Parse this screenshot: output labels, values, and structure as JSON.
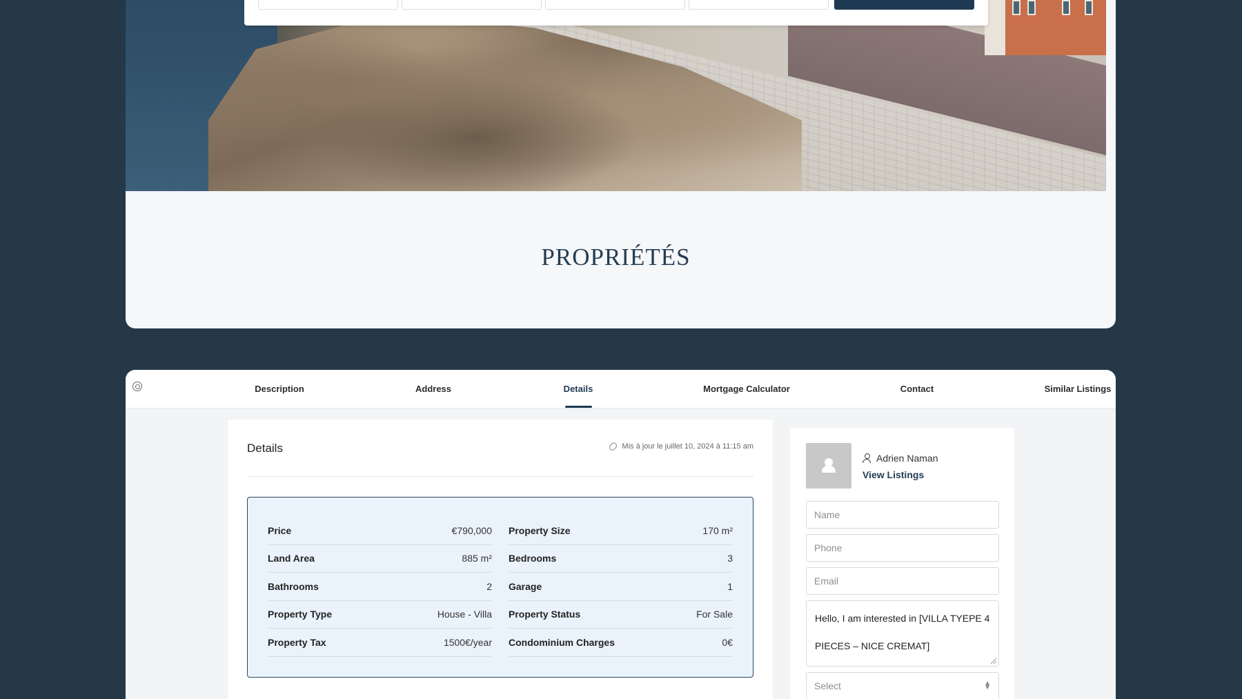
{
  "section": {
    "title": "PROPRIÉTÉS"
  },
  "tabs": [
    {
      "label": "Description"
    },
    {
      "label": "Address"
    },
    {
      "label": "Details"
    },
    {
      "label": "Mortgage Calculator"
    },
    {
      "label": "Contact"
    },
    {
      "label": "Similar Listings"
    }
  ],
  "active_tab": "Details",
  "details": {
    "heading": "Details",
    "updated": "Mis à jour le juillet 10, 2024 à 11:15 am",
    "left": [
      {
        "key": "Price",
        "value": "€790,000"
      },
      {
        "key": "Land Area",
        "value": "885 m²"
      },
      {
        "key": "Bathrooms",
        "value": "2"
      },
      {
        "key": "Property Type",
        "value": "House - Villa"
      },
      {
        "key": "Property Tax",
        "value": "1500€/year"
      }
    ],
    "right": [
      {
        "key": "Property Size",
        "value": "170 m²"
      },
      {
        "key": "Bedrooms",
        "value": "3"
      },
      {
        "key": "Garage",
        "value": "1"
      },
      {
        "key": "Property Status",
        "value": "For Sale"
      },
      {
        "key": "Condominium Charges",
        "value": "0€"
      }
    ]
  },
  "contact": {
    "agent_name": "Adrien Naman",
    "view_listings": "View Listings",
    "name_placeholder": "Name",
    "phone_placeholder": "Phone",
    "email_placeholder": "Email",
    "message_line1": "Hello, I am interested in [VILLA TYEPE 4",
    "message_line2": "PIECES – NICE CREMAT]",
    "select_value": "Select"
  },
  "colors": {
    "accent": "#1e3a52",
    "background": "#253847",
    "details_box": "#eaf2fb"
  }
}
